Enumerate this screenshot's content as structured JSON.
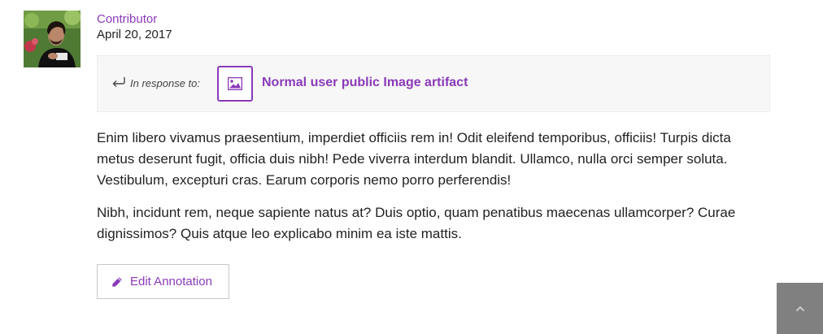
{
  "author": {
    "role": "Contributor",
    "date": "April 20, 2017"
  },
  "response": {
    "label": "In response to:",
    "artifact_title": "Normal user public Image artifact",
    "artifact_icon": "image-icon"
  },
  "body": {
    "paragraphs": [
      "Enim libero vivamus praesentium, imperdiet officiis rem in! Odit eleifend temporibus, officiis! Turpis dicta metus deserunt fugit, officia duis nibh! Pede viverra interdum blandit. Ullamco, nulla orci semper soluta. Vestibulum, excepturi cras. Earum corporis nemo porro perferendis!",
      "Nibh, incidunt rem, neque sapiente natus at? Duis optio, quam penatibus maecenas ullamcorper? Curae dignissimos? Quis atque leo explicabo minim ea iste mattis."
    ]
  },
  "actions": {
    "edit_label": "Edit Annotation",
    "edit_icon": "pencil-icon",
    "scroll_top_icon": "chevron-up-icon"
  },
  "colors": {
    "accent": "#8a3ab9",
    "text": "#222222",
    "box_background": "#f7f7f7",
    "scroll_button": "#808080"
  }
}
